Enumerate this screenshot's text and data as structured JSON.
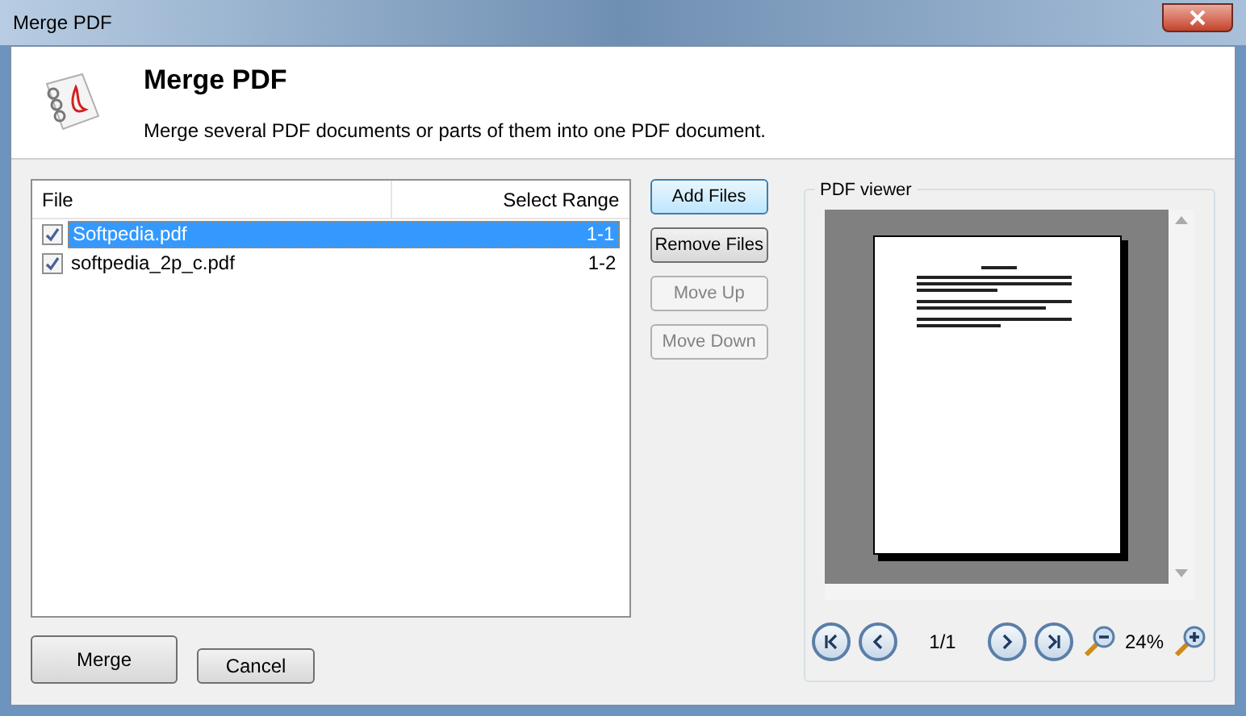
{
  "window": {
    "title": "Merge PDF"
  },
  "header": {
    "title": "Merge PDF",
    "subtitle": "Merge several PDF documents or parts of them into one PDF document."
  },
  "file_list": {
    "columns": [
      "File",
      "Select Range"
    ],
    "rows": [
      {
        "name": "Softpedia.pdf",
        "range": "1-1",
        "checked": true,
        "selected": true
      },
      {
        "name": "softpedia_2p_c.pdf",
        "range": "1-2",
        "checked": true,
        "selected": false
      }
    ]
  },
  "side_buttons": [
    {
      "label": "Add Files",
      "disabled": false,
      "focused": true
    },
    {
      "label": "Remove Files",
      "disabled": false,
      "focused": false
    },
    {
      "label": "Move Up",
      "disabled": true,
      "focused": false
    },
    {
      "label": "Move Down",
      "disabled": true,
      "focused": false
    }
  ],
  "viewer": {
    "title": "PDF viewer",
    "page": "1/1",
    "zoom": "24%"
  },
  "bottom_buttons": [
    {
      "label": "Merge",
      "kind": "primary"
    },
    {
      "label": "Cancel",
      "kind": "secondary"
    }
  ]
}
